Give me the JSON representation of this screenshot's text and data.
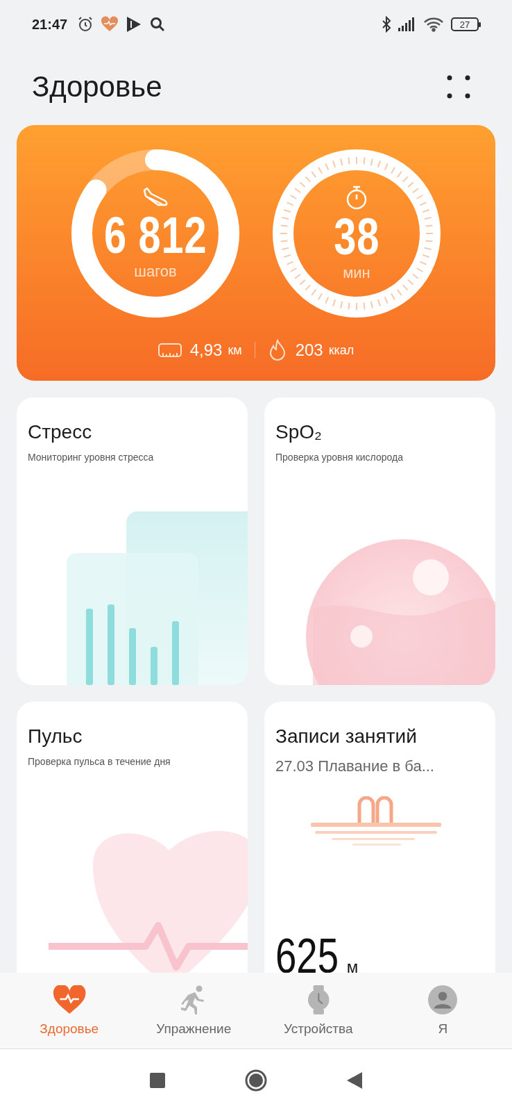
{
  "status_bar": {
    "time": "21:47",
    "battery": "27"
  },
  "header": {
    "title": "Здоровье"
  },
  "activity": {
    "steps": {
      "value": "6 812",
      "unit": "шагов"
    },
    "minutes": {
      "value": "38",
      "unit": "мин"
    },
    "distance": {
      "value": "4,93",
      "unit": "км"
    },
    "calories": {
      "value": "203",
      "unit": "ккал"
    }
  },
  "tiles": [
    {
      "kind": "stress",
      "title": "Стресс",
      "subtitle": "Мониторинг уровня стресса"
    },
    {
      "kind": "spo2",
      "title": "SpO₂",
      "subtitle": "Проверка уровня кислорода"
    },
    {
      "kind": "pulse",
      "title": "Пульс",
      "subtitle": "Проверка пульса в течение дня"
    },
    {
      "kind": "workout",
      "title": "Записи занятий",
      "subtitle": "27.03 Плавание в ба...",
      "value": "625",
      "unit": "м"
    }
  ],
  "bottom_nav": [
    {
      "kind": "health",
      "label": "Здоровье",
      "selected": true
    },
    {
      "kind": "exercise",
      "label": "Упражнение",
      "selected": false
    },
    {
      "kind": "devices",
      "label": "Устройства",
      "selected": false
    },
    {
      "kind": "me",
      "label": "Я",
      "selected": false
    }
  ]
}
